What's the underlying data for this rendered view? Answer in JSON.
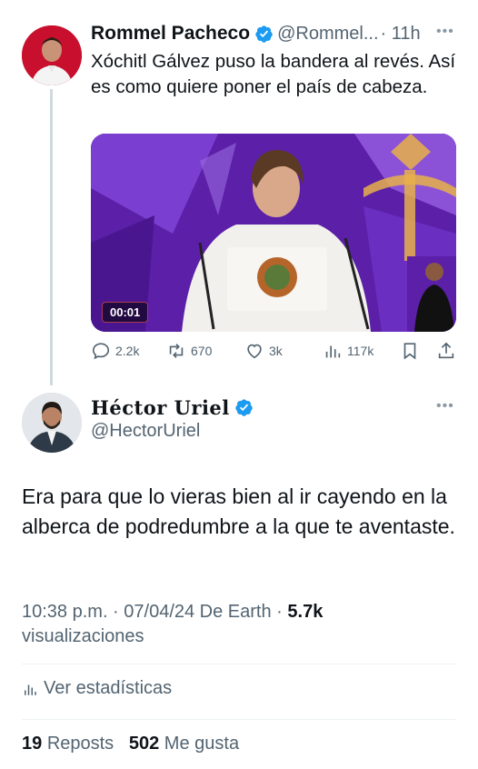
{
  "tweet1": {
    "author_name": "Rommel Pacheco",
    "handle": "@Rommel...",
    "time": "· 11h",
    "text": "Xóchitl Gálvez puso la bandera al revés. Así es como quiere poner el país de cabeza.",
    "media": {
      "timer": "00:01"
    },
    "actions": {
      "replies": "2.2k",
      "reposts": "670",
      "likes": "3k",
      "views": "117k"
    }
  },
  "tweet2": {
    "author_name": "Héctor Uriel",
    "handle": "@HectorUriel",
    "text": "Era para que lo vieras bien al ir cayendo en la alberca de podredumbre a la que te aventaste.",
    "timestamp": "10:38 p.m. · 07/04/24 De Earth ·",
    "views_count": "5.7k",
    "views_label": "visualizaciones",
    "stats_label": "Ver estadísticas",
    "reposts_count": "19",
    "reposts_label": "Reposts",
    "likes_count": "502",
    "likes_label": "Me gusta"
  },
  "colors": {
    "verified": "#1d9bf0",
    "secondary_text": "#536471",
    "primary_text": "#0f1419",
    "media_purple": "#5b1fa8"
  }
}
